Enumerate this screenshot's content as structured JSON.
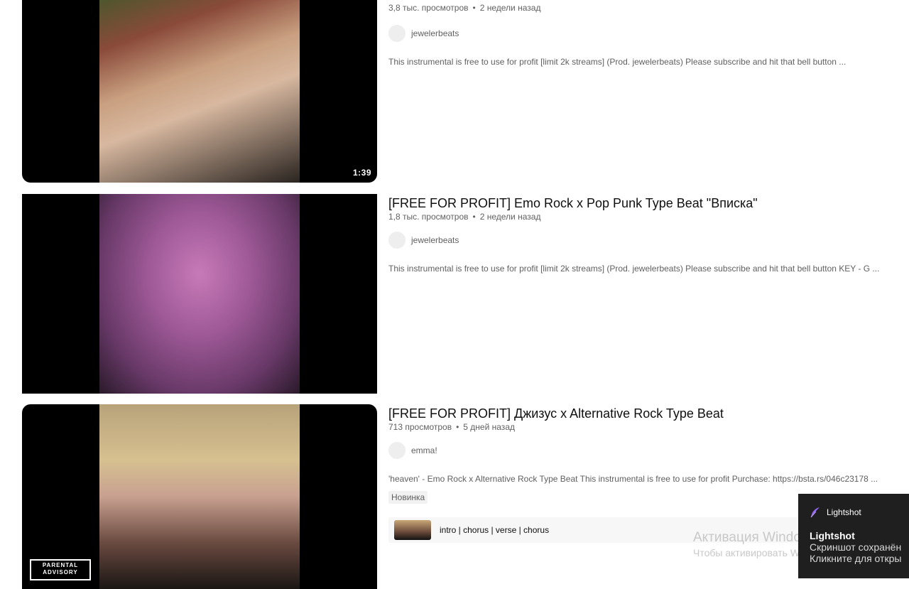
{
  "results": [
    {
      "title": "",
      "views": "3,8 тыс. просмотров",
      "age": "2 недели назад",
      "channel": "jewelerbeats",
      "description": "This instrumental is free to use for profit [limit 2k streams] (Prod. jewelerbeats) Please subscribe and hit that bell button ...",
      "duration": "1:39"
    },
    {
      "title": "[FREE FOR PROFIT] Emo Rock x Pop Punk Type Beat \"Вписка\"",
      "views": "1,8 тыс. просмотров",
      "age": "2 недели назад",
      "channel": "jewelerbeats",
      "description": "This instrumental is free to use for profit [limit 2k streams] (Prod. jewelerbeats) Please subscribe and hit that bell button KEY - G ..."
    },
    {
      "title": "[FREE FOR PROFIT] Джизус x Alternative Rock Type Beat",
      "views": "713 просмотров",
      "age": "5 дней назад",
      "channel": "emma!",
      "description": "'heaven' - Emo Rock x Alternative Rock Type Beat This instrumental is free to use for profit Purchase: https://bsta.rs/046c23178 ...",
      "badge": "Новинка",
      "chapters": "intro | chorus | verse | chorus",
      "thumb_text": "PARENTAL ADVISORY"
    }
  ],
  "separator": "•",
  "windows_watermark": {
    "line1": "Активация Windows",
    "line2": "Чтобы активировать Windows, перейдите в"
  },
  "lightshot": {
    "app": "Lightshot",
    "title": "Lightshot",
    "line1": "Скриншот сохранён",
    "line2": "Кликните для откры"
  },
  "colors": {
    "accent_feather": "#9b6bff",
    "thumb_bg": "#000000"
  }
}
